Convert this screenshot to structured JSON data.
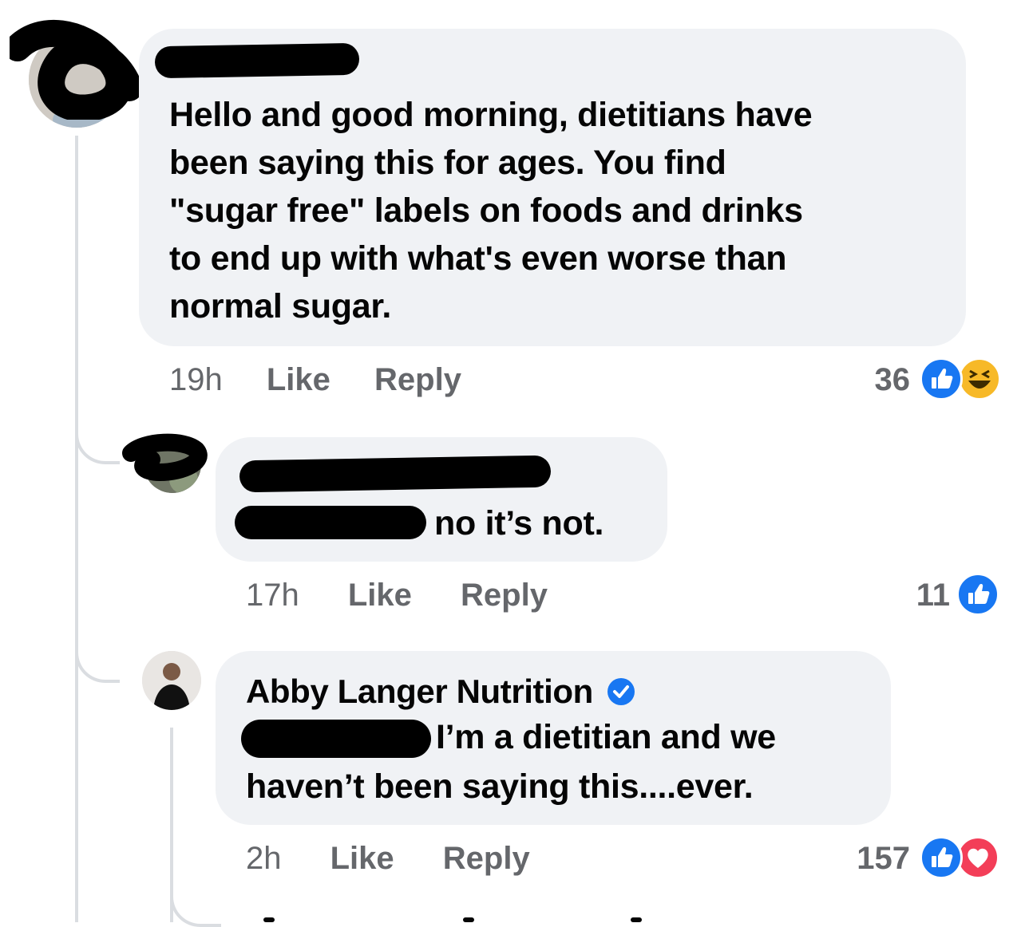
{
  "comments": [
    {
      "author": "",
      "text": "Hello and good morning, dietitians have\nbeen saying this for ages. You find\n\"sugar free\" labels on foods and drinks\nto end up with what's even worse than\nnormal sugar.",
      "time": "19h",
      "like_label": "Like",
      "reply_label": "Reply",
      "reaction_count": "36",
      "reactions": [
        "like-icon",
        "haha-icon"
      ]
    },
    {
      "author": "",
      "text": "no it’s not.",
      "time": "17h",
      "like_label": "Like",
      "reply_label": "Reply",
      "reaction_count": "11",
      "reactions": [
        "like-icon"
      ]
    },
    {
      "author": "Abby Langer Nutrition",
      "verified": true,
      "text_line1": "I’m a dietitian and we",
      "text_line2": "haven’t been saying this....ever.",
      "time": "2h",
      "like_label": "Like",
      "reply_label": "Reply",
      "reaction_count": "157",
      "reactions": [
        "like-icon",
        "love-icon"
      ]
    }
  ],
  "colors": {
    "bubble": "#f0f2f5",
    "meta_text": "#65676b",
    "like_blue": "#1877f2",
    "haha_yellow": "#f7b928",
    "love_red": "#f33e58",
    "thread_line": "#dadde1"
  }
}
